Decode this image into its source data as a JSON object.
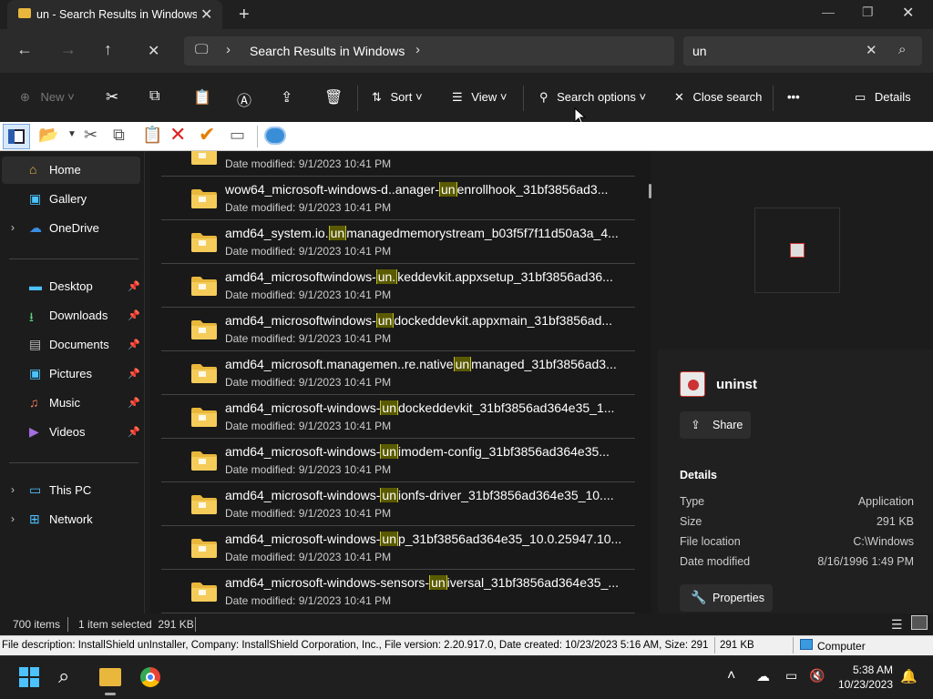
{
  "window": {
    "tab_title": "un - Search Results in Windows",
    "tab_close": "✕",
    "new_tab": "+",
    "minimize": "—",
    "maximize": "❐",
    "close": "✕"
  },
  "nav": {
    "back": "←",
    "forward": "→",
    "up": "↑",
    "stop": "✕",
    "pc_icon": "🖵",
    "sep": "›",
    "path": "Search Results in Windows",
    "search_value": "un",
    "search_clear": "✕",
    "search_icon": "⌕"
  },
  "commandbar": {
    "new": "New",
    "sort": "Sort",
    "view": "View",
    "search_options": "Search options",
    "close_search": "Close search",
    "more": "•••",
    "details": "Details"
  },
  "sidebar": {
    "items": [
      {
        "label": "Home",
        "icon": "home-icon"
      },
      {
        "label": "Gallery",
        "icon": "gallery-icon"
      },
      {
        "label": "OneDrive",
        "icon": "cloud-icon"
      },
      {
        "label": "Desktop",
        "icon": "desktop-icon"
      },
      {
        "label": "Downloads",
        "icon": "download-icon"
      },
      {
        "label": "Documents",
        "icon": "documents-icon"
      },
      {
        "label": "Pictures",
        "icon": "pictures-icon"
      },
      {
        "label": "Music",
        "icon": "music-icon"
      },
      {
        "label": "Videos",
        "icon": "videos-icon"
      },
      {
        "label": "This PC",
        "icon": "pc-icon"
      },
      {
        "label": "Network",
        "icon": "network-icon"
      }
    ]
  },
  "files": [
    {
      "pre": "wow64_microsoft-windows-d..anager-",
      "hl": "un",
      "post": "enrollhook_31bf3856ad3...",
      "date": "Date modified: 9/1/2023 10:41 PM"
    },
    {
      "pre": "amd64_system.io.",
      "hl": "un",
      "post": "managedmemorystream_b03f5f7f11d50a3a_4...",
      "date": "Date modified: 9/1/2023 10:41 PM"
    },
    {
      "pre": "amd64_microsoftwindows-",
      "hl": "un.",
      "post": "keddevkit.appxsetup_31bf3856ad36...",
      "date": "Date modified: 9/1/2023 10:41 PM"
    },
    {
      "pre": "amd64_microsoftwindows-",
      "hl": "un",
      "post": "dockeddevkit.appxmain_31bf3856ad...",
      "date": "Date modified: 9/1/2023 10:41 PM"
    },
    {
      "pre": "amd64_microsoft.managemen..re.native",
      "hl": "un",
      "post": "managed_31bf3856ad3...",
      "date": "Date modified: 9/1/2023 10:41 PM"
    },
    {
      "pre": "amd64_microsoft-windows-",
      "hl": "un",
      "post": "dockeddevkit_31bf3856ad364e35_1...",
      "date": "Date modified: 9/1/2023 10:41 PM"
    },
    {
      "pre": "amd64_microsoft-windows-",
      "hl": "un",
      "post": "imodem-config_31bf3856ad364e35...",
      "date": "Date modified: 9/1/2023 10:41 PM"
    },
    {
      "pre": "amd64_microsoft-windows-",
      "hl": "un",
      "post": "ionfs-driver_31bf3856ad364e35_10....",
      "date": "Date modified: 9/1/2023 10:41 PM"
    },
    {
      "pre": "amd64_microsoft-windows-",
      "hl": "un",
      "post": "p_31bf3856ad364e35_10.0.25947.10...",
      "date": "Date modified: 9/1/2023 10:41 PM"
    },
    {
      "pre": "amd64_microsoft-windows-sensors-",
      "hl": "un",
      "post": "iversal_31bf3856ad364e35_...",
      "date": "Date modified: 9/1/2023 10:41 PM"
    }
  ],
  "partial_row_date": "Date modified: 9/1/2023 10:41 PM",
  "details": {
    "name": "uninst",
    "share": "Share",
    "heading": "Details",
    "rows": [
      {
        "label": "Type",
        "value": "Application"
      },
      {
        "label": "Size",
        "value": "291 KB"
      },
      {
        "label": "File location",
        "value": "C:\\Windows"
      },
      {
        "label": "Date modified",
        "value": "8/16/1996 1:49 PM"
      }
    ],
    "properties": "Properties"
  },
  "status": {
    "count": "700 items",
    "selected": "1 item selected  291 KB",
    "description": "File description: InstallShield unInstaller, Company: InstallShield Corporation, Inc., File version: 2.20.917.0, Date created: 10/23/2023 5:16 AM, Size: 291",
    "size": "291 KB",
    "computer": "Computer"
  },
  "taskbar": {
    "time": "5:38 AM",
    "date": "10/23/2023"
  },
  "colors": {
    "highlight": "#bdbd2b",
    "folder": "#e8b73c",
    "accent": "#4cc2ff"
  }
}
